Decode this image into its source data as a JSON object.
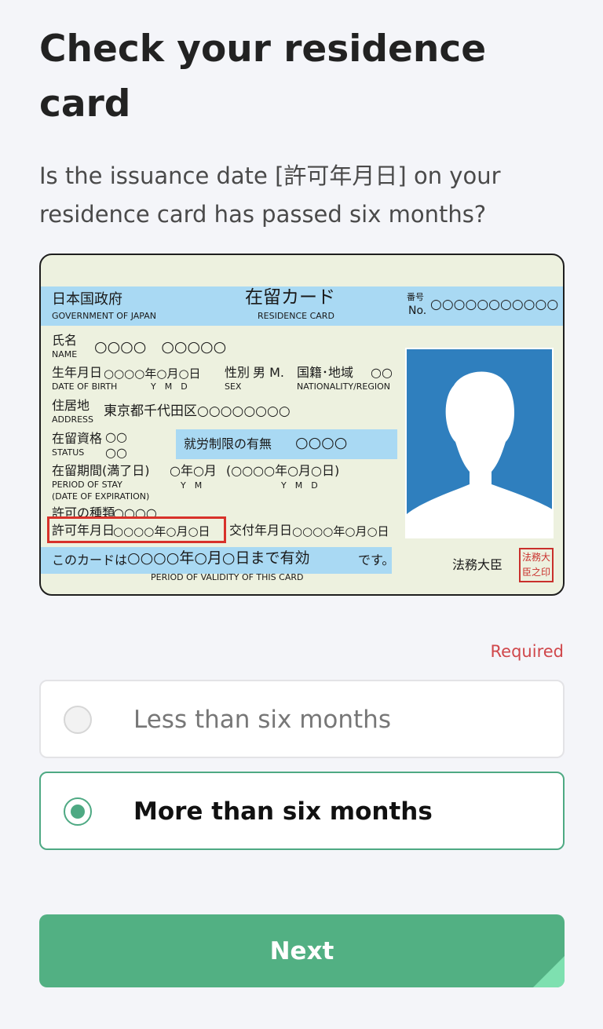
{
  "page": {
    "title": "Check your residence card",
    "question": "Is the issuance date [許可年月日] on your residence card has passed six months?",
    "required_label": "Required",
    "next_label": "Next"
  },
  "options": [
    {
      "label": "Less than six months",
      "selected": false
    },
    {
      "label": "More than six months",
      "selected": true
    }
  ],
  "card": {
    "gov_jp": "日本国政府",
    "gov_en": "GOVERNMENT OF JAPAN",
    "card_jp": "在留カード",
    "card_en": "RESIDENCE CARD",
    "number_jp": "番号",
    "number_en": "No.",
    "number_value": "○○○○○○○○○○○",
    "name_jp": "氏名",
    "name_en": "NAME",
    "name_value": "○○○○　○○○○○",
    "dob_jp": "生年月日",
    "dob_en": "DATE OF BIRTH",
    "dob_value": "○○○○年○月○日",
    "dob_units": "Y　M　D",
    "sex_jp": "性別",
    "sex_en": "SEX",
    "sex_value": "男 M.",
    "nat_jp": "国籍･地域",
    "nat_en": "NATIONALITY/REGION",
    "nat_value": "○○",
    "addr_jp": "住居地",
    "addr_en": "ADDRESS",
    "addr_value": "東京都千代田区○○○○○○○○",
    "status_jp": "在留資格",
    "status_en": "STATUS",
    "status_value": "○○",
    "status_value2": "○○",
    "work_jp": "就労制限の有無",
    "work_value": "○○○○",
    "period_jp": "在留期間(満了日)",
    "period_en": "PERIOD OF STAY",
    "period_en2": "(DATE OF EXPIRATION)",
    "period_value": "○年○月",
    "period_units": "Y　M",
    "period_expiry": "(○○○○年○月○日)",
    "period_expiry_units": "Y　M　D",
    "permit_type_jp": "許可の種類",
    "permit_type_value": "○○○○",
    "permit_date_jp": "許可年月日",
    "permit_date_value": "○○○○年○月○日",
    "issue_date_jp": "交付年月日",
    "issue_date_value": "○○○○年○月○日",
    "validity_prefix": "このカードは",
    "validity_value": "○○○○年○月○日まで有効",
    "validity_suffix": "です。",
    "validity_en": "PERIOD OF VALIDITY OF THIS CARD",
    "minister": "法務大臣",
    "seal_line1": "法務大",
    "seal_line2": "臣之印"
  },
  "colors": {
    "accent": "#52b083",
    "required": "#d0474b",
    "card_blue": "#a9d9f3",
    "card_bg": "#edf1df",
    "photo_bg": "#2f7fbe",
    "highlight": "#d8322a"
  }
}
